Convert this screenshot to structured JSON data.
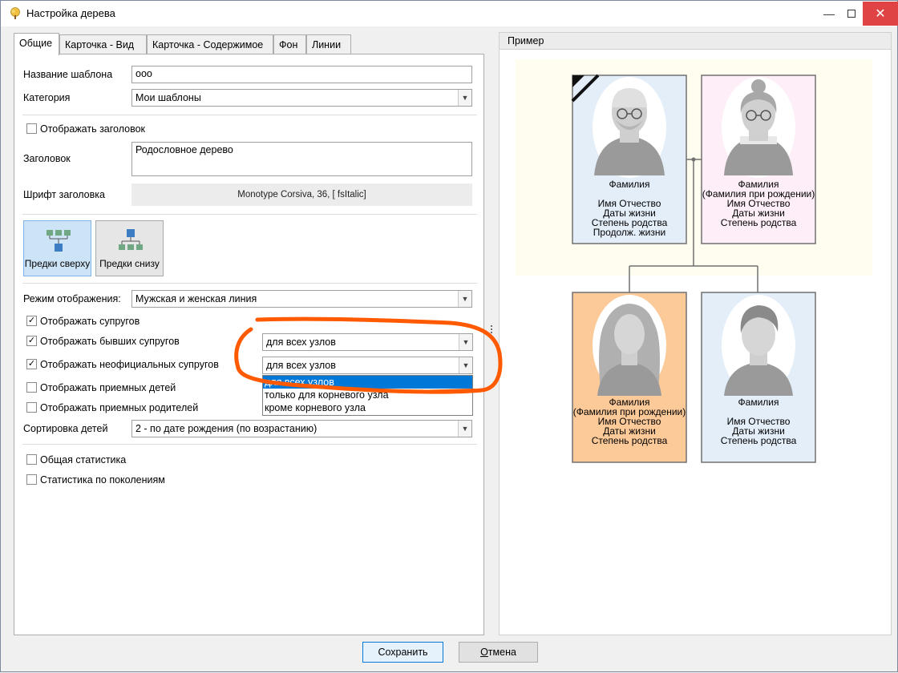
{
  "window": {
    "title": "Настройка дерева"
  },
  "tabs": [
    {
      "label": "Общие"
    },
    {
      "label": "Карточка - Вид"
    },
    {
      "label": "Карточка - Содержимое"
    },
    {
      "label": "Фон"
    },
    {
      "label": "Линии"
    }
  ],
  "general": {
    "template_name_label": "Название шаблона",
    "template_name_value": "ооо",
    "category_label": "Категория",
    "category_value": "Мои шаблоны",
    "show_header_label": "Отображать заголовок",
    "show_header_checked": false,
    "header_label": "Заголовок",
    "header_value": "Родословное дерево",
    "header_font_label": "Шрифт заголовка",
    "header_font_value": "Monotype Corsiva, 36, [ fsItalic]",
    "ancestors_top_label": "Предки сверху",
    "ancestors_bottom_label": "Предки снизу",
    "display_mode_label": "Режим отображения:",
    "display_mode_value": "Мужская и женская линия",
    "show_spouses_label": "Отображать супругов",
    "show_ex_spouses_label": "Отображать бывших супругов",
    "ex_spouses_value": "для всех узлов",
    "show_unofficial_label": "Отображать неофициальных супругов",
    "unofficial_value": "для всех узлов",
    "show_adopted_children_label": "Отображать приемных детей",
    "show_adoptive_parents_label": "Отображать приемных родителей",
    "sort_children_label": "Сортировка детей",
    "sort_children_value": "2 - по дате рождения (по возрастанию)",
    "overall_stats_label": "Общая статистика",
    "generation_stats_label": "Статистика по поколениям"
  },
  "dropdown_options": [
    {
      "label": "для всех узлов",
      "selected": true
    },
    {
      "label": "только для корневого узла",
      "selected": false
    },
    {
      "label": "кроме корневого узла",
      "selected": false
    }
  ],
  "preview": {
    "title": "Пример",
    "cards": [
      {
        "lines": [
          "Фамилия",
          "",
          "Имя Отчество",
          "Даты жизни",
          "Степень родства",
          "Продолж. жизни"
        ],
        "bg": "#e3eef9"
      },
      {
        "lines": [
          "Фамилия",
          "(Фамилия при рождении)",
          "Имя Отчество",
          "Даты жизни",
          "Степень родства"
        ],
        "bg": "#fdeef7"
      },
      {
        "lines": [
          "Фамилия",
          "(Фамилия при рождении)",
          "Имя Отчество",
          "Даты жизни",
          "Степень родства"
        ],
        "bg": "#fcc998"
      },
      {
        "lines": [
          "Фамилия",
          "",
          "Имя Отчество",
          "Даты жизни",
          "Степень родства"
        ],
        "bg": "#e3eef9"
      }
    ]
  },
  "buttons": {
    "save": "Сохранить",
    "cancel_prefix": "",
    "cancel_mnemonic": "О",
    "cancel_rest": "тмена"
  },
  "colors": {
    "accent": "#0078d7",
    "annotation": "#ff5a00",
    "close": "#e04343"
  }
}
